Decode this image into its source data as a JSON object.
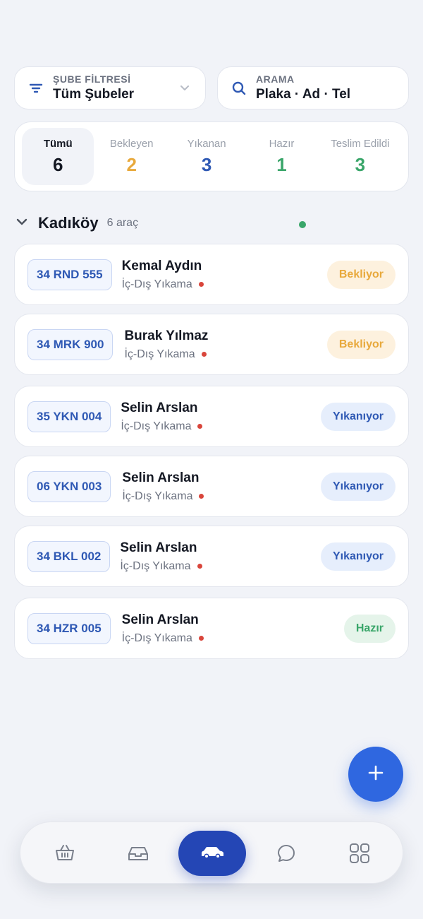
{
  "filter": {
    "label": "ŞUBE FİLTRESİ",
    "value": "Tüm Şubeler"
  },
  "search": {
    "label": "ARAMA",
    "value": "Plaka · Ad · Tel"
  },
  "tabs": [
    {
      "label": "Tümü",
      "count": "6",
      "color": "#141823"
    },
    {
      "label": "Bekleyen",
      "count": "2",
      "color": "#e8a93c"
    },
    {
      "label": "Yıkanan",
      "count": "3",
      "color": "#2f59b4"
    },
    {
      "label": "Hazır",
      "count": "1",
      "color": "#3aa66a"
    },
    {
      "label": "Teslim Edildi",
      "count": "3",
      "color": "#3aa66a"
    }
  ],
  "group": {
    "title": "Kadıköy",
    "count": "6 araç"
  },
  "records": [
    {
      "plate": "34 RND 555",
      "name": "Kemal Aydın",
      "service": "İç-Dış Yıkama",
      "status": "Bekliyor",
      "status_bg": "#fdf1de",
      "status_color": "#e8a93c"
    },
    {
      "plate": "34 MRK 900",
      "name": "Burak Yılmaz",
      "service": "İç-Dış Yıkama",
      "status": "Bekliyor",
      "status_bg": "#fdf1de",
      "status_color": "#e8a93c"
    },
    {
      "plate": "35 YKN 004",
      "name": "Selin Arslan",
      "service": "İç-Dış Yıkama",
      "status": "Yıkanıyor",
      "status_bg": "#e6eefc",
      "status_color": "#2f59b4"
    },
    {
      "plate": "06 YKN 003",
      "name": "Selin Arslan",
      "service": "İç-Dış Yıkama",
      "status": "Yıkanıyor",
      "status_bg": "#e6eefc",
      "status_color": "#2f59b4"
    },
    {
      "plate": "34 BKL 002",
      "name": "Selin Arslan",
      "service": "İç-Dış Yıkama",
      "status": "Yıkanıyor",
      "status_bg": "#e6eefc",
      "status_color": "#2f59b4"
    },
    {
      "plate": "34 HZR 005",
      "name": "Selin Arslan",
      "service": "İç-Dış Yıkama",
      "status": "Hazır",
      "status_bg": "#e5f4ea",
      "status_color": "#3aa66a"
    }
  ],
  "nav": [
    "basket-icon",
    "inbox-icon",
    "car-icon",
    "chat-icon",
    "grid-icon"
  ],
  "accent": "#2f67e0"
}
